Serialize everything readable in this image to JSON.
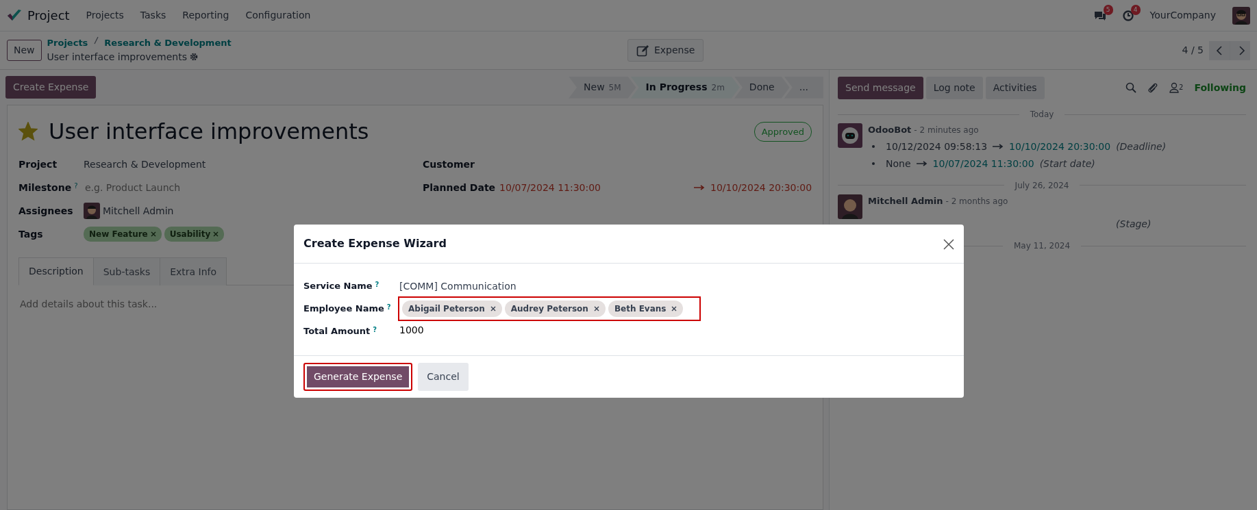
{
  "navbar": {
    "app": "Project",
    "menus": [
      "Projects",
      "Tasks",
      "Reporting",
      "Configuration"
    ],
    "messages_badge": "5",
    "activities_badge": "4",
    "company": "YourCompany"
  },
  "control_panel": {
    "new_button": "New",
    "breadcrumbs": [
      "Projects",
      "Research & Development"
    ],
    "record": "User interface improvements",
    "smart_button": "Expense",
    "pager": "4 / 5"
  },
  "action_bar": {
    "button": "Create Expense",
    "stages": [
      {
        "label": "New",
        "duration": "5M",
        "selected": false
      },
      {
        "label": "In Progress",
        "duration": "2m",
        "selected": true
      },
      {
        "label": "Done",
        "selected": false
      }
    ],
    "more": "..."
  },
  "form": {
    "starred": true,
    "title": "User interface improvements",
    "status_badge": "Approved",
    "left_fields": [
      {
        "kind": "text",
        "label": "Project",
        "value": "Research & Development"
      },
      {
        "kind": "placeholder",
        "label": "Milestone",
        "help": "?",
        "placeholder": "e.g. Product Launch"
      },
      {
        "kind": "user",
        "label": "Assignees",
        "value": "Mitchell Admin"
      },
      {
        "kind": "tags",
        "label": "Tags",
        "tags": [
          "New Feature",
          "Usability"
        ]
      }
    ],
    "right_fields": [
      {
        "kind": "text",
        "label": "Customer"
      },
      {
        "kind": "daterange",
        "label": "Planned Date",
        "start": "10/07/2024 11:30:00",
        "end": "10/10/2024 20:30:00"
      }
    ],
    "tabs": [
      {
        "label": "Description",
        "selected": true
      },
      {
        "label": "Sub-tasks",
        "selected": false
      },
      {
        "label": "Extra Info",
        "selected": false
      }
    ],
    "description_placeholder": "Add details about this task..."
  },
  "chatter": {
    "buttons": [
      {
        "label": "Send message",
        "primary": true
      },
      {
        "label": "Log note",
        "primary": false
      },
      {
        "label": "Activities",
        "primary": false
      }
    ],
    "followers": "2",
    "follow": "Following",
    "groups": [
      {
        "date": "Today",
        "messages": [
          {
            "author": "OdooBot",
            "time": "- 2 minutes ago",
            "changes": [
              {
                "old": "10/12/2024 09:58:13",
                "new": "10/10/2024 20:30:00",
                "field": "(Deadline)"
              },
              {
                "old": "None",
                "new": "10/07/2024 11:30:00",
                "field": "(Start date)"
              }
            ]
          }
        ]
      },
      {
        "date": "July 26, 2024",
        "messages": [
          {
            "author": "Mitchell Admin",
            "time": "- 2 months ago",
            "changes": [
              {
                "field": "(Stage)"
              }
            ]
          }
        ]
      },
      {
        "date": "May 11, 2024"
      }
    ]
  },
  "dialog": {
    "title": "Create Expense Wizard",
    "fields": [
      {
        "kind": "text",
        "label": "Service Name",
        "help": "?",
        "value": "[COMM] Communication",
        "highlighted": false
      },
      {
        "kind": "tags",
        "label": "Employee Name",
        "help": "?",
        "tags": [
          "Abigail Peterson",
          "Audrey Peterson",
          "Beth Evans"
        ],
        "highlighted": true
      },
      {
        "kind": "input",
        "label": "Total Amount",
        "help": "?",
        "value": "1000",
        "highlighted": false
      }
    ],
    "buttons": [
      {
        "label": "Generate Expense",
        "primary": true,
        "highlighted": true
      },
      {
        "label": "Cancel",
        "primary": false,
        "highlighted": false
      }
    ]
  }
}
